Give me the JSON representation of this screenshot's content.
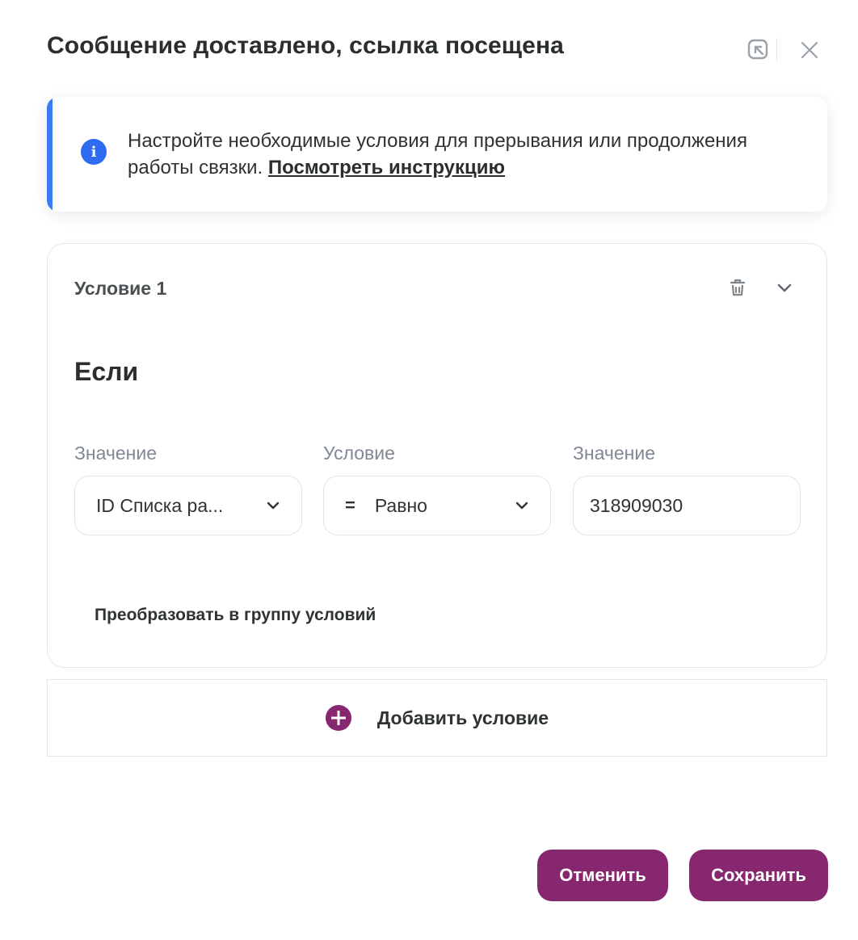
{
  "dialog": {
    "title": "Сообщение доставлено, ссылка посещена",
    "icons": [
      "collapse-icon",
      "close-icon"
    ]
  },
  "info": {
    "text": "Настройте необходимые условия для прерывания или продолжения работы связки. ",
    "link_label": "Посмотреть инструкцию",
    "accent_color": "#3b7cf5"
  },
  "condition": {
    "title": "Условие 1",
    "if_label": "Если",
    "fields": {
      "value1": {
        "label": "Значение",
        "selected": "ID Списка ра..."
      },
      "operator": {
        "label": "Условие",
        "symbol": "=",
        "selected": "Равно"
      },
      "value2": {
        "label": "Значение",
        "value": "318909030"
      }
    },
    "convert_label": "Преобразовать в группу условий"
  },
  "add_condition": {
    "label": "Добавить условие"
  },
  "footer": {
    "cancel_label": "Отменить",
    "save_label": "Сохранить",
    "brand_color": "#86276f"
  }
}
